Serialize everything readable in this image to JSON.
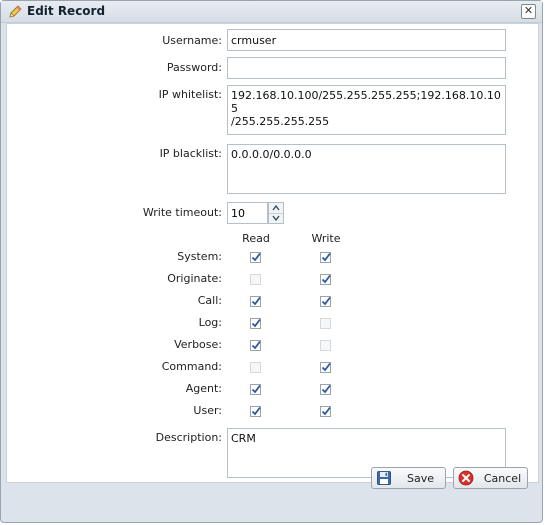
{
  "window": {
    "title": "Edit Record"
  },
  "form": {
    "username": {
      "label": "Username:",
      "value": "crmuser"
    },
    "password": {
      "label": "Password:",
      "value": ""
    },
    "ip_whitelist": {
      "label": "IP whitelist:",
      "value": "192.168.10.100/255.255.255.255;192.168.10.105\n/255.255.255.255"
    },
    "ip_blacklist": {
      "label": "IP blacklist:",
      "value": "0.0.0.0/0.0.0.0"
    },
    "write_timeout": {
      "label": "Write timeout:",
      "value": "10"
    },
    "permissions": {
      "read_header": "Read",
      "write_header": "Write",
      "rows": [
        {
          "label": "System:",
          "read": {
            "checked": true,
            "disabled": false
          },
          "write": {
            "checked": true,
            "disabled": false
          }
        },
        {
          "label": "Originate:",
          "read": {
            "checked": false,
            "disabled": true
          },
          "write": {
            "checked": true,
            "disabled": false
          }
        },
        {
          "label": "Call:",
          "read": {
            "checked": true,
            "disabled": false
          },
          "write": {
            "checked": true,
            "disabled": false
          }
        },
        {
          "label": "Log:",
          "read": {
            "checked": true,
            "disabled": false
          },
          "write": {
            "checked": false,
            "disabled": true
          }
        },
        {
          "label": "Verbose:",
          "read": {
            "checked": true,
            "disabled": false
          },
          "write": {
            "checked": false,
            "disabled": true
          }
        },
        {
          "label": "Command:",
          "read": {
            "checked": false,
            "disabled": true
          },
          "write": {
            "checked": true,
            "disabled": false
          }
        },
        {
          "label": "Agent:",
          "read": {
            "checked": true,
            "disabled": false
          },
          "write": {
            "checked": true,
            "disabled": false
          }
        },
        {
          "label": "User:",
          "read": {
            "checked": true,
            "disabled": false
          },
          "write": {
            "checked": true,
            "disabled": false
          }
        }
      ]
    },
    "description": {
      "label": "Description:",
      "value": "CRM"
    }
  },
  "buttons": {
    "save": "Save",
    "cancel": "Cancel"
  },
  "icons": {
    "title": "pencil-icon",
    "close": "close-icon",
    "save": "floppy-disk-icon",
    "cancel": "cancel-icon"
  },
  "colors": {
    "accent": "#2a5a9c",
    "cancel_red": "#d9312a"
  }
}
